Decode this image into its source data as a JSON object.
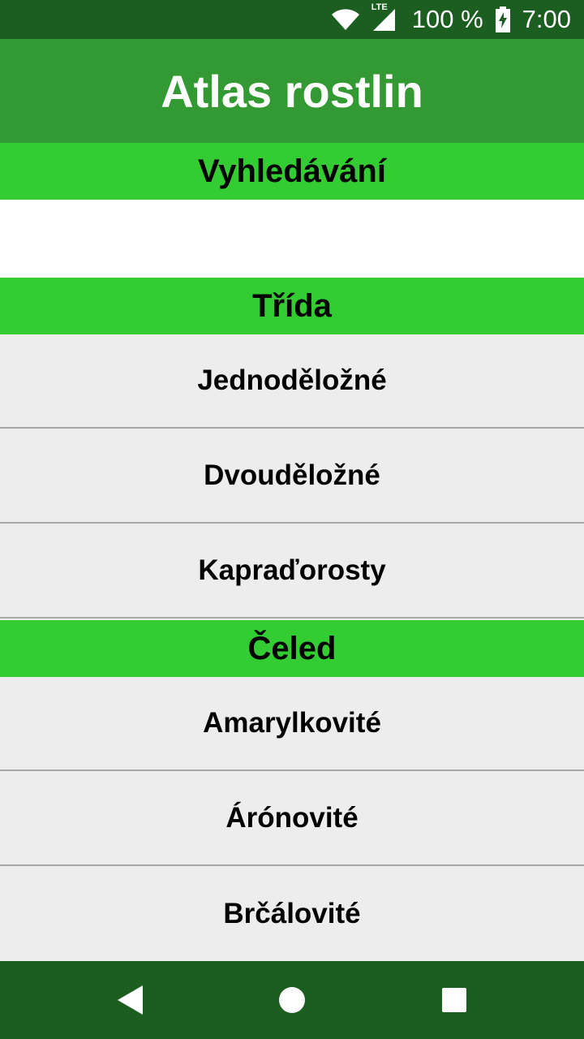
{
  "status_bar": {
    "network": "LTE",
    "battery": "100 %",
    "time": "7:00",
    "icons": [
      "wifi-icon",
      "signal-icon",
      "battery-charging-icon"
    ]
  },
  "app_bar": {
    "title": "Atlas rostlin"
  },
  "search_section": {
    "header": "Vyhledávání",
    "value": "",
    "placeholder": ""
  },
  "class_section": {
    "header": "Třída",
    "items": [
      "Jednoděložné",
      "Dvouděložné",
      "Kapraďorosty"
    ]
  },
  "family_section": {
    "header": "Čeled",
    "items": [
      "Amarylkovité",
      "Árónovité",
      "Brčálovité"
    ]
  },
  "nav_bar": {
    "icons": [
      "back-icon",
      "home-icon",
      "recents-icon"
    ]
  },
  "colors": {
    "status_bar": "#1b5e20",
    "app_bar": "#339933",
    "section_header": "#33cc33",
    "list_bg": "#ededed",
    "nav_bar": "#1b5e20"
  }
}
